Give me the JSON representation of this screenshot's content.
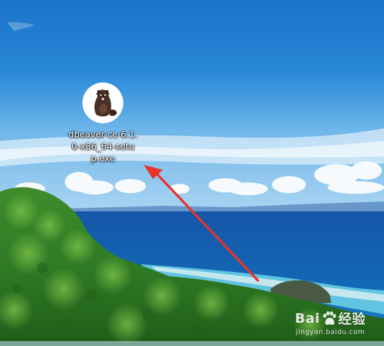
{
  "desktop": {
    "icons": [
      {
        "label": "dbeaver-ce-6.1.0-x86_64-setup.exe",
        "icon": "beaver-icon"
      }
    ]
  },
  "annotation": {
    "arrow_color": "#e8322a"
  },
  "watermark": {
    "brand_left": "Bai",
    "brand_right": "经验",
    "site": "jingyan.baidu.com"
  }
}
